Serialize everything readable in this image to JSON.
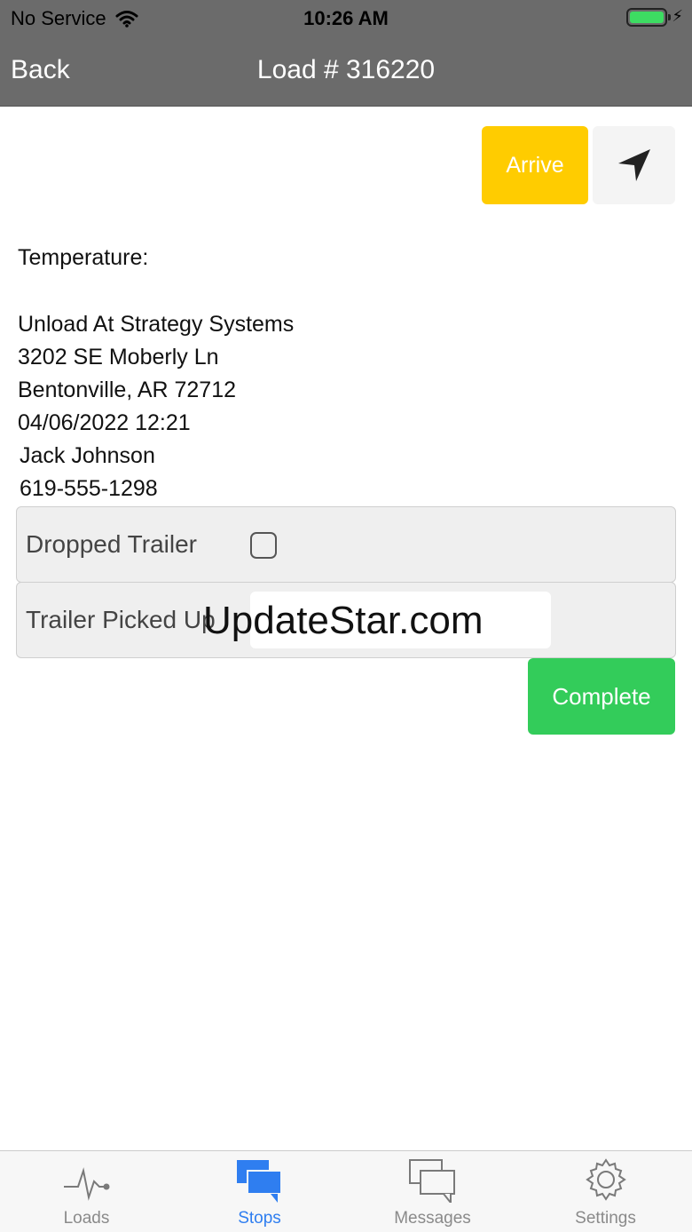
{
  "status_bar": {
    "carrier": "No Service",
    "time": "10:26 AM",
    "battery_level": 1.0,
    "battery_color": "#3ddc62"
  },
  "nav_bar": {
    "back_label": "Back",
    "title": "Load # 316220"
  },
  "actions": {
    "arrive_label": "Arrive",
    "arrive_color": "#ffcc00",
    "navigate_icon": "navigation-arrow-icon",
    "complete_label": "Complete",
    "complete_color": "#33cc5a"
  },
  "stop": {
    "temperature_label": "Temperature:",
    "unload_line": "Unload At Strategy Systems",
    "street": "3202 SE Moberly Ln",
    "city_state_zip": "Bentonville, AR 72712",
    "datetime": "04/06/2022 12:21",
    "contact_name": "Jack Johnson",
    "contact_phone": "619-555-1298"
  },
  "options": {
    "dropped_trailer_label": "Dropped Trailer",
    "dropped_trailer_checked": false,
    "trailer_picked_up_label": "Trailer Picked Up"
  },
  "watermark": {
    "text": "UpdateStar.com"
  },
  "tabs": [
    {
      "label": "Loads",
      "icon": "pulse-icon",
      "active": false
    },
    {
      "label": "Stops",
      "icon": "chat-bubbles-icon",
      "active": true
    },
    {
      "label": "Messages",
      "icon": "messages-icon",
      "active": false
    },
    {
      "label": "Settings",
      "icon": "gear-icon",
      "active": false
    }
  ],
  "colors": {
    "header_bg": "#6b6b6b",
    "tab_active": "#2f7ef0",
    "tab_inactive": "#8a8a8a"
  }
}
